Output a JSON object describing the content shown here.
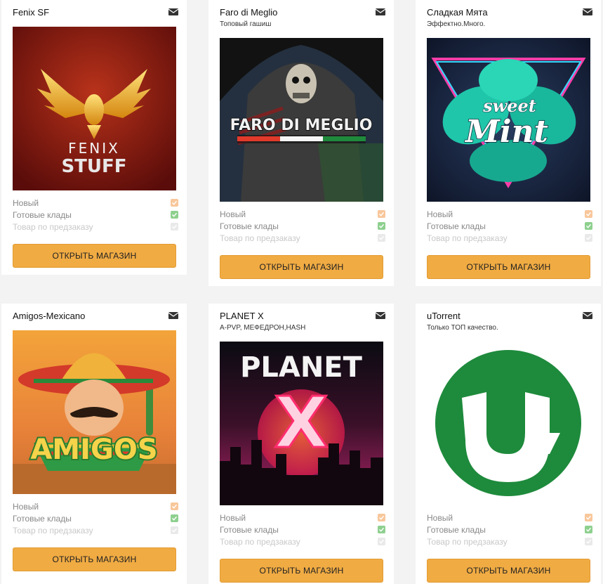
{
  "button_label": "ОТКРЫТЬ МАГАЗИН",
  "features": [
    "Новый",
    "Готовые клады",
    "Товар по предзаказу"
  ],
  "shops": [
    {
      "name": "Fenix SF",
      "tagline": "",
      "image_text": [
        "FENIX",
        "STUFF"
      ]
    },
    {
      "name": "Faro di Meglio",
      "tagline": "Топовый гашиш",
      "image_text": [
        "FARO DI MEGLIO"
      ]
    },
    {
      "name": "Сладкая Мята",
      "tagline": "Эффектно.Много.",
      "image_text": [
        "sweet",
        "Mint"
      ]
    },
    {
      "name": "Amigos-Mexicano",
      "tagline": "",
      "image_text": [
        "AMIGOS"
      ]
    },
    {
      "name": "PLANET X",
      "tagline": "A-PVP, МЕФЕДРОН,HASH",
      "image_text": [
        "PLANET",
        "X"
      ]
    },
    {
      "name": "uTorrent",
      "tagline": "Только ТОП качество.",
      "image_text": []
    }
  ],
  "colors": {
    "button": "#f0ab43",
    "new_badge": "#f8c79b",
    "ready_badge": "#8ed08f"
  },
  "icons": {
    "message": "envelope-icon"
  }
}
